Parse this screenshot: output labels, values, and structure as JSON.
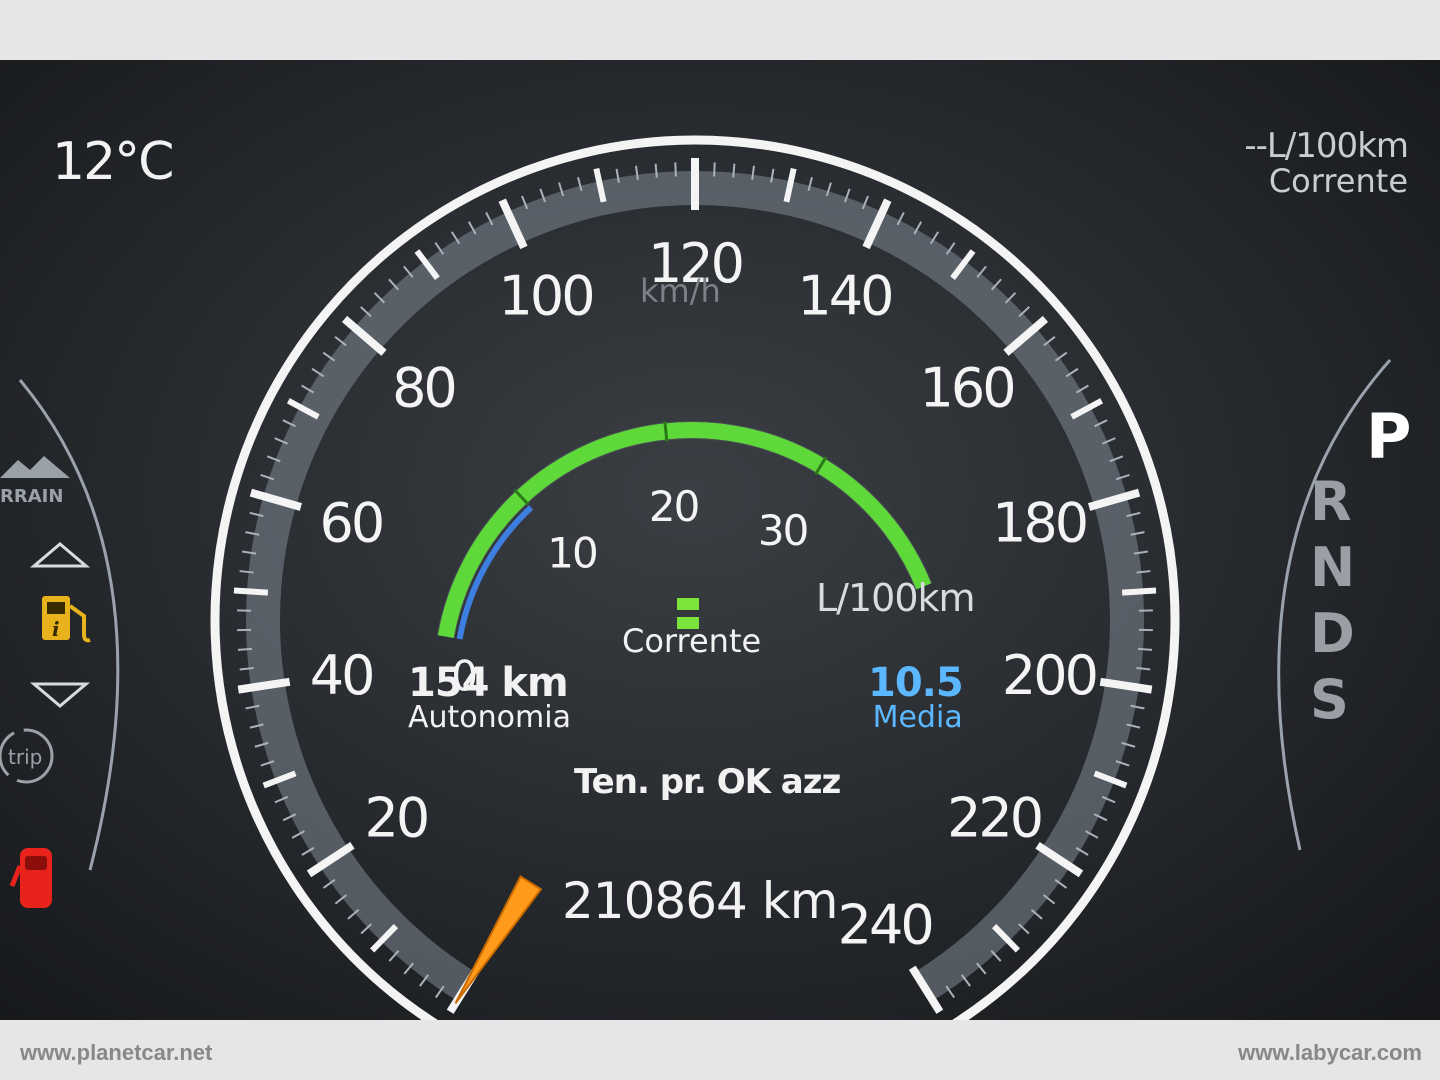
{
  "cluster": {
    "outside_temp": "12°C",
    "fuel_current": {
      "value": "--L/100km",
      "label": "Corrente"
    },
    "speedometer": {
      "unit": "km/h",
      "ticks": [
        "0",
        "20",
        "40",
        "60",
        "80",
        "100",
        "120",
        "140",
        "160",
        "180",
        "200",
        "220",
        "240"
      ],
      "needle_value": 0
    },
    "consumption_gauge": {
      "ticks": [
        "0",
        "10",
        "20",
        "30"
      ],
      "unit": "L/100km",
      "current_display": "--",
      "current_label": "Corrente",
      "average_value": 10.5,
      "bar_fill_green": 1.0,
      "bar_fill_blue": 0.25
    },
    "range": {
      "value": "154 km",
      "label": "Autonomia"
    },
    "average": {
      "value": "10.5",
      "label": "Media"
    },
    "status_message": "Ten. pr. OK azz",
    "odometer": "210864 km",
    "gear_selector": {
      "selected": "P",
      "options": [
        "R",
        "N",
        "D",
        "S"
      ]
    },
    "left_panel": {
      "terrain_label": "RRAIN",
      "trip_label": "trip"
    },
    "colors": {
      "green_bar": "#5fd93a",
      "blue_bar": "#3d7fe0",
      "needle": "#ff9a1a",
      "average_text": "#5bb8ff",
      "warning_red": "#e8231c",
      "fuel_icon": "#e8b21c"
    }
  },
  "footer": {
    "left": "www.planetcar.net",
    "right": "www.labycar.com"
  }
}
